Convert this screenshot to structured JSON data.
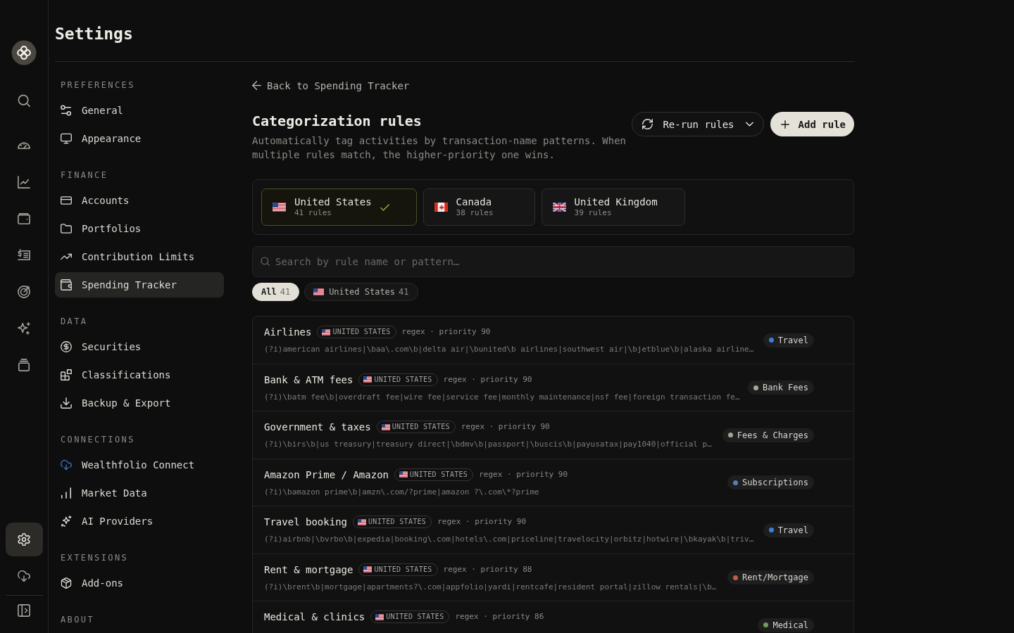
{
  "rail": {
    "top": [
      {
        "selected": false
      },
      {
        "selected": false
      },
      {
        "selected": false
      },
      {
        "selected": false
      },
      {
        "selected": false
      },
      {
        "selected": false
      },
      {
        "selected": false
      },
      {
        "selected": false
      }
    ],
    "bottom": [
      {
        "selected": true
      },
      {
        "selected": false
      }
    ]
  },
  "page": {
    "title": "Settings"
  },
  "settings_nav": {
    "sections": [
      {
        "heading": "PREFERENCES",
        "items": [
          {
            "label": "General",
            "selected": false
          },
          {
            "label": "Appearance",
            "selected": false
          }
        ]
      },
      {
        "heading": "FINANCE",
        "items": [
          {
            "label": "Accounts",
            "selected": false
          },
          {
            "label": "Portfolios",
            "selected": false
          },
          {
            "label": "Contribution Limits",
            "selected": false
          },
          {
            "label": "Spending Tracker",
            "selected": true
          }
        ]
      },
      {
        "heading": "DATA",
        "items": [
          {
            "label": "Securities",
            "selected": false
          },
          {
            "label": "Classifications",
            "selected": false
          },
          {
            "label": "Backup & Export",
            "selected": false
          }
        ]
      },
      {
        "heading": "CONNECTIONS",
        "items": [
          {
            "label": "Wealthfolio Connect",
            "selected": false
          },
          {
            "label": "Market Data",
            "selected": false
          },
          {
            "label": "AI Providers",
            "selected": false
          }
        ]
      },
      {
        "heading": "EXTENSIONS",
        "items": [
          {
            "label": "Add-ons",
            "selected": false
          }
        ]
      },
      {
        "heading": "ABOUT"
      }
    ]
  },
  "rules_page": {
    "back_link": "Back to Spending Tracker",
    "title": "Categorization rules",
    "description": "Automatically tag activities by transaction-name patterns. When multiple rules match, the higher-priority one wins.",
    "rerun_button": "Re-run rules",
    "add_button": "Add rule",
    "countries": [
      {
        "kind": "us",
        "name": "United States",
        "count": "41 rules",
        "selected": true
      },
      {
        "kind": "ca",
        "name": "Canada",
        "count": "38 rules",
        "selected": false
      },
      {
        "kind": "gb",
        "name": "United Kingdom",
        "count": "39 rules",
        "selected": false
      }
    ],
    "search": {
      "placeholder": "Search by rule name or pattern…"
    },
    "filters": [
      {
        "kind": "all",
        "label": "All",
        "count": "41",
        "selected": true
      },
      {
        "kind": "us",
        "label": "United States",
        "count": "41",
        "selected": false
      }
    ],
    "rules": [
      {
        "name": "Airlines",
        "tag": {
          "kind": "us",
          "label": "UNITED STATES"
        },
        "meta": "regex · priority 90",
        "pattern": "(?i)american airlines|\\baa\\.com\\b|delta air|\\bunited\\b airlines|southwest air|\\bjetblue\\b|alaska airline…",
        "category": {
          "label": "Travel",
          "color": "#3d7dd6"
        }
      },
      {
        "name": "Bank & ATM fees",
        "tag": {
          "kind": "us",
          "label": "UNITED STATES"
        },
        "meta": "regex · priority 90",
        "pattern": "(?i)\\batm fee\\b|overdraft fee|wire fee|service fee|monthly maintenance|nsf fee|foreign transaction fe…",
        "category": {
          "label": "Bank Fees",
          "color": "#a8a798"
        }
      },
      {
        "name": "Government & taxes",
        "tag": {
          "kind": "us",
          "label": "UNITED STATES"
        },
        "meta": "regex · priority 90",
        "pattern": "(?i)\\birs\\b|us treasury|treasury direct|\\bdmv\\b|passport|\\buscis\\b|payusatax|pay1040|official p…",
        "category": {
          "label": "Fees & Charges",
          "color": "#a3a293"
        }
      },
      {
        "name": "Amazon Prime / Amazon",
        "tag": {
          "kind": "us",
          "label": "UNITED STATES"
        },
        "meta": "regex · priority 90",
        "pattern": "(?i)\\bamazon prime\\b|amzn\\.com/?prime|amazon ?\\.com\\*?prime",
        "category": {
          "label": "Subscriptions",
          "color": "#5b7bb8"
        }
      },
      {
        "name": "Travel booking",
        "tag": {
          "kind": "us",
          "label": "UNITED STATES"
        },
        "meta": "regex · priority 90",
        "pattern": "(?i)airbnb|\\bvrbo\\b|expedia|booking\\.com|hotels\\.com|priceline|travelocity|orbitz|hotwire|\\bkayak\\b|triv…",
        "category": {
          "label": "Travel",
          "color": "#3d7dd6"
        }
      },
      {
        "name": "Rent & mortgage",
        "tag": {
          "kind": "us",
          "label": "UNITED STATES"
        },
        "meta": "regex · priority 88",
        "pattern": "(?i)\\brent\\b|mortgage|apartments?\\.com|appfolio|yardi|rentcafe|resident portal|zillow rentals|\\b…",
        "category": {
          "label": "Rent/Mortgage",
          "color": "#c2603f"
        }
      },
      {
        "name": "Medical & clinics",
        "tag": {
          "kind": "us",
          "label": "UNITED STATES"
        },
        "meta": "regex · priority 86",
        "category": {
          "label": "Medical",
          "color": "#6e9f58"
        }
      }
    ]
  }
}
